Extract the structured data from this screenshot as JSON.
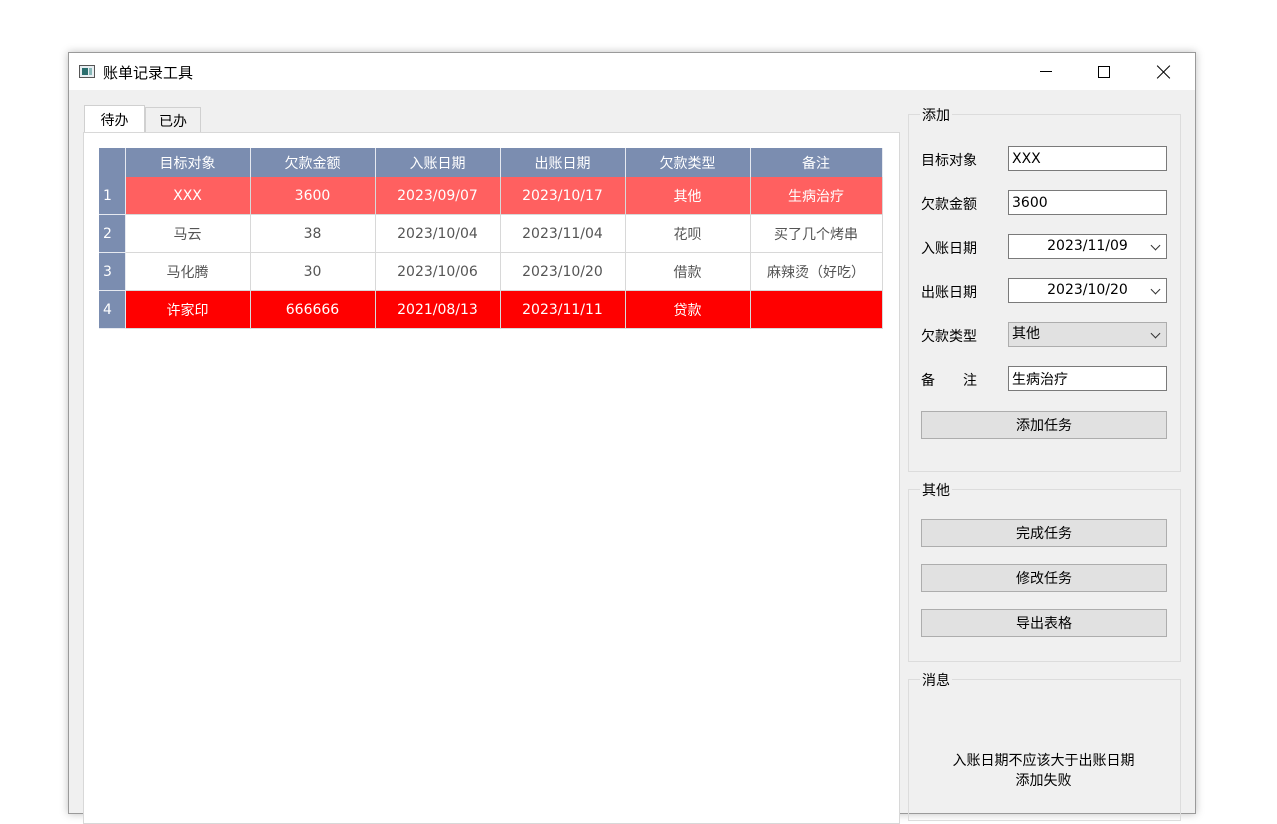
{
  "window": {
    "title": "账单记录工具"
  },
  "tabs": [
    {
      "label": "待办"
    },
    {
      "label": "已办"
    }
  ],
  "table": {
    "columns": [
      "目标对象",
      "欠款金额",
      "入账日期",
      "出账日期",
      "欠款类型",
      "备注"
    ],
    "rows": [
      {
        "num": "1",
        "cells": [
          "XXX",
          "3600",
          "2023/09/07",
          "2023/10/17",
          "其他",
          "生病治疗"
        ],
        "status": "warn"
      },
      {
        "num": "2",
        "cells": [
          "马云",
          "38",
          "2023/10/04",
          "2023/11/04",
          "花呗",
          "买了几个烤串"
        ],
        "status": "normal"
      },
      {
        "num": "3",
        "cells": [
          "马化腾",
          "30",
          "2023/10/06",
          "2023/10/20",
          "借款",
          "麻辣烫（好吃）"
        ],
        "status": "normal"
      },
      {
        "num": "4",
        "cells": [
          "许家印",
          "666666",
          "2021/08/13",
          "2023/11/11",
          "贷款",
          ""
        ],
        "status": "alert"
      }
    ],
    "colors": {
      "header": "#7b8db0",
      "warn": "#ff6060",
      "alert": "#ff0000"
    }
  },
  "add": {
    "title": "添加",
    "target_label": "目标对象",
    "target_value": "XXX",
    "amount_label": "欠款金额",
    "amount_value": "3600",
    "in_date_label": "入账日期",
    "in_date_value": "2023/11/09",
    "out_date_label": "出账日期",
    "out_date_value": "2023/10/20",
    "type_label": "欠款类型",
    "type_value": "其他",
    "note_label": "备　　注",
    "note_value": "生病治疗",
    "add_button": "添加任务"
  },
  "other": {
    "title": "其他",
    "complete_button": "完成任务",
    "modify_button": "修改任务",
    "export_button": "导出表格"
  },
  "message": {
    "title": "消息",
    "line1": "入账日期不应该大于出账日期",
    "line2": "添加失败"
  },
  "icons": [
    "app-icon",
    "minimize-icon",
    "maximize-icon",
    "close-icon",
    "chevron-down-icon"
  ]
}
